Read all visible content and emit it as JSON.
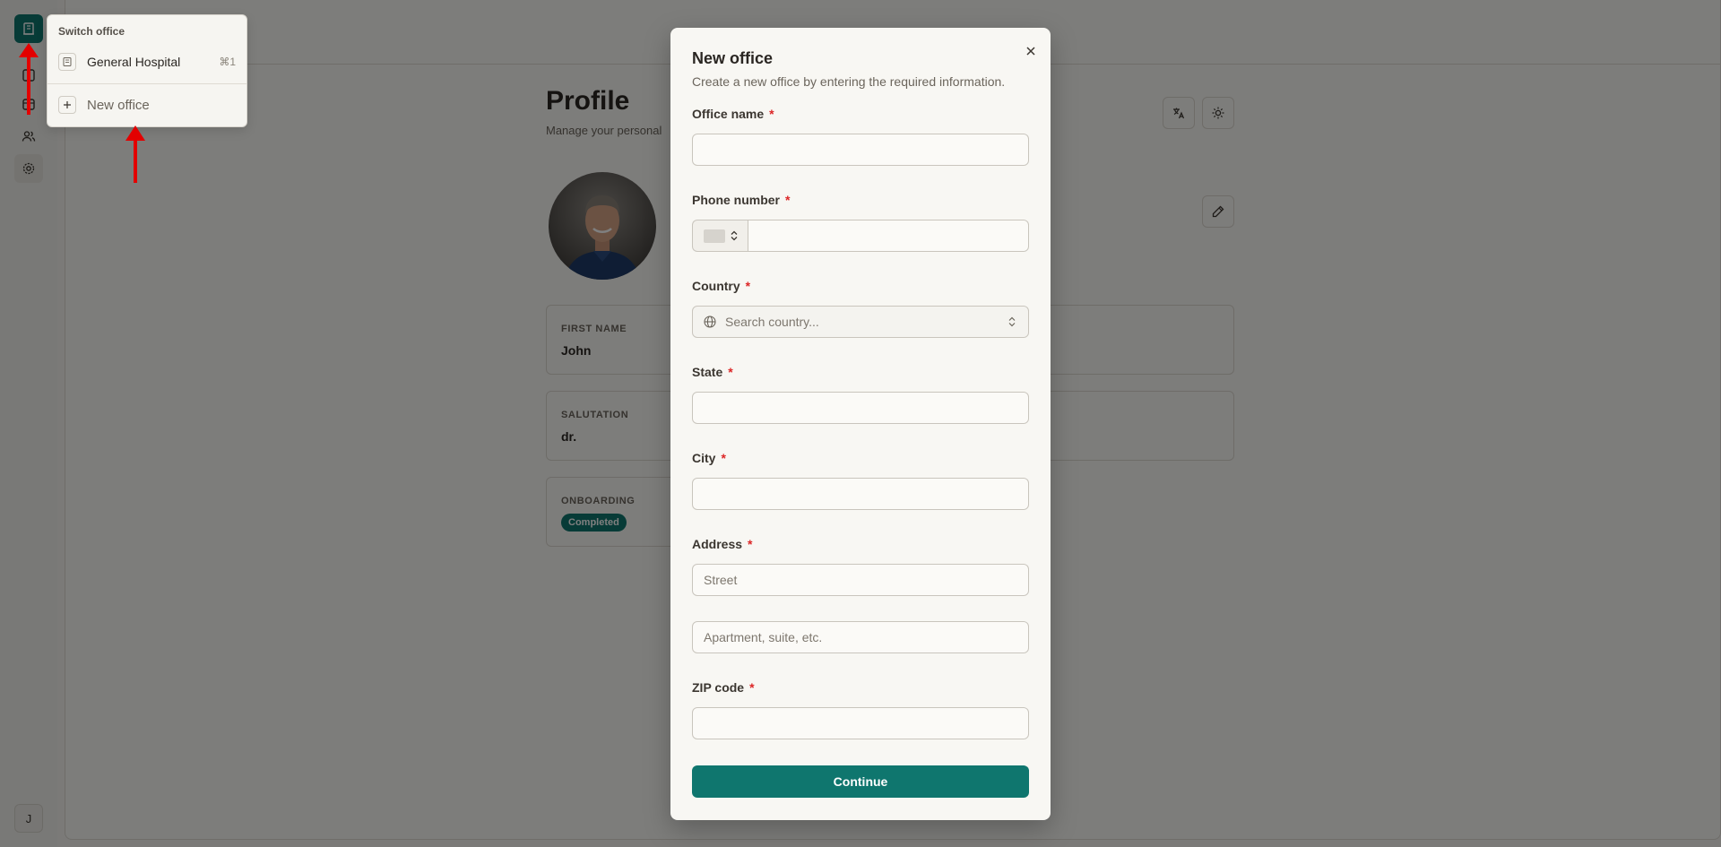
{
  "page": {
    "title": "Profile",
    "subtitle": "Manage your personal"
  },
  "sidebar": {
    "avatar_initial": "J"
  },
  "profile": {
    "fields": [
      {
        "label": "FIRST NAME",
        "value": "John"
      },
      {
        "label": "SALUTATION",
        "value": "dr."
      },
      {
        "label": "ONBOARDING",
        "value": "Completed"
      }
    ]
  },
  "office_menu": {
    "title": "Switch office",
    "items": [
      {
        "label": "General Hospital",
        "shortcut": "⌘1"
      }
    ],
    "new_office_label": "New office"
  },
  "modal": {
    "title": "New office",
    "description": "Create a new office by entering the required information.",
    "fields": {
      "office_name": {
        "label": "Office name",
        "value": ""
      },
      "phone_number": {
        "label": "Phone number",
        "value": ""
      },
      "country": {
        "label": "Country",
        "placeholder": "Search country..."
      },
      "state": {
        "label": "State",
        "value": ""
      },
      "city": {
        "label": "City",
        "value": ""
      },
      "address": {
        "label": "Address",
        "street_placeholder": "Street",
        "apt_placeholder": "Apartment, suite, etc."
      },
      "zip": {
        "label": "ZIP code",
        "value": ""
      }
    },
    "required_marker": "*",
    "continue_label": "Continue"
  },
  "colors": {
    "accent": "#0f766e",
    "required": "#dc2626",
    "annotation": "#e30000"
  }
}
